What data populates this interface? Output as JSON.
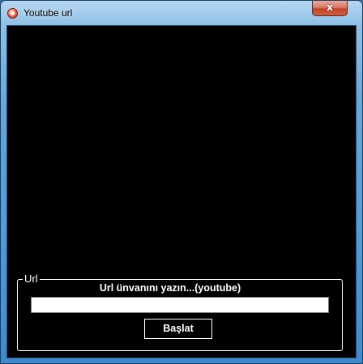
{
  "window": {
    "title": "Youtube url",
    "close_glyph": "x",
    "icon": "app-icon"
  },
  "group": {
    "legend": "Url",
    "label": "Url ünvanını yazın...(youtube)",
    "input_value": "",
    "input_placeholder": "",
    "button_label": "Başlat"
  },
  "colors": {
    "client_background": "#000000",
    "text": "#ffffff",
    "input_background": "#ffffff",
    "close_button": "#c4452a"
  }
}
